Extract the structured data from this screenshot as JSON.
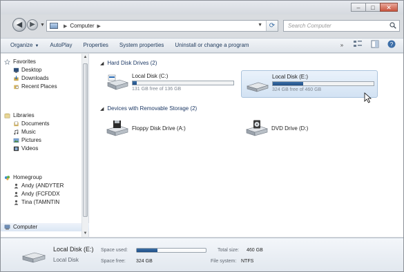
{
  "window": {
    "controls": {
      "minimize": "–",
      "maximize": "□",
      "close": "✕"
    }
  },
  "address": {
    "crumbs": [
      "Computer"
    ],
    "search_placeholder": "Search Computer"
  },
  "toolbar": {
    "items": [
      "Organize",
      "AutoPlay",
      "Properties",
      "System properties",
      "Uninstall or change a program"
    ]
  },
  "nav": {
    "favorites": {
      "label": "Favorites",
      "items": [
        "Desktop",
        "Downloads",
        "Recent Places"
      ]
    },
    "libraries": {
      "label": "Libraries",
      "items": [
        "Documents",
        "Music",
        "Pictures",
        "Videos"
      ]
    },
    "homegroup": {
      "label": "Homegroup",
      "items": [
        "Andy (ANDYTER",
        "Andy (FCFDDX",
        "Tina (TAMNTIN"
      ]
    },
    "computer": {
      "label": "Computer"
    }
  },
  "main": {
    "hdd_group": "Hard Disk Drives (2)",
    "removable_group": "Devices with Removable Storage (2)",
    "drives": [
      {
        "name": "Local Disk (C:)",
        "free_text": "131 GB free of 136 GB",
        "used_fraction": 0.04
      },
      {
        "name": "Local Disk (E:)",
        "free_text": "324 GB free of 460 GB",
        "used_fraction": 0.3
      }
    ],
    "devices": [
      {
        "name": "Floppy Disk Drive (A:)"
      },
      {
        "name": "DVD Drive (D:)"
      }
    ]
  },
  "details": {
    "name": "Local Disk (E:)",
    "type": "Local Disk",
    "space_used_label": "Space used:",
    "space_used_fraction": 0.3,
    "space_free_label": "Space free:",
    "space_free": "324 GB",
    "total_size_label": "Total size:",
    "total_size": "460 GB",
    "fs_label": "File system:",
    "fs": "NTFS"
  },
  "colors": {
    "accent": "#1f4f86",
    "selection": "#d2e2f3"
  }
}
